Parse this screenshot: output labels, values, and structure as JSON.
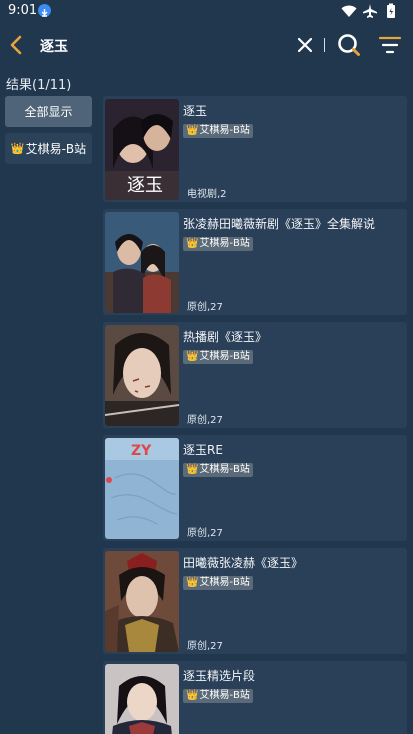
{
  "status_bar": {
    "time": "9:01"
  },
  "toolbar": {
    "query": "逐玉",
    "icons": [
      "back-arrow-icon",
      "close-icon",
      "search-icon",
      "filter-icon"
    ],
    "accent_color": "#e8a33a"
  },
  "results": {
    "label": "结果(1/11)"
  },
  "sidebar": {
    "all_label": "全部显示",
    "source_label": "艾棋易-B站",
    "crown": "👑"
  },
  "items": [
    {
      "title": "逐玉",
      "source": "艾棋易-B站",
      "meta": "电视剧,2",
      "poster_text": "逐玉"
    },
    {
      "title": "张凌赫田曦薇新剧《逐玉》全集解说",
      "source": "艾棋易-B站",
      "meta": "原创,27"
    },
    {
      "title": "热播剧《逐玉》",
      "source": "艾棋易-B站",
      "meta": "原创,27"
    },
    {
      "title": "逐玉RE",
      "source": "艾棋易-B站",
      "meta": "原创,27",
      "poster_text": "ZY"
    },
    {
      "title": "田曦薇张凌赫《逐玉》",
      "source": "艾棋易-B站",
      "meta": "原创,27"
    },
    {
      "title": "逐玉精选片段",
      "source": "艾棋易-B站",
      "meta": ""
    }
  ]
}
